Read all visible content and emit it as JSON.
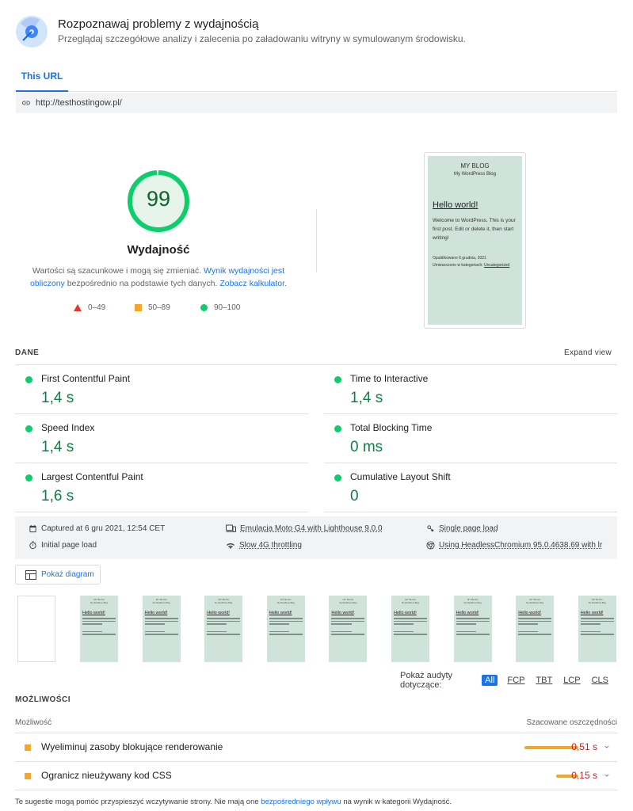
{
  "header": {
    "title": "Rozpoznawaj problemy z wydajnością",
    "subtitle": "Przeglądaj szczegółowe analizy i zalecenia po załadowaniu witryny w symulowanym środowisku."
  },
  "tabs": [
    {
      "label": "This URL",
      "active": true
    }
  ],
  "url": "http://testhostingow.pl/",
  "score": {
    "value": "99",
    "fraction": 0.99,
    "label": "Wydajność",
    "desc_1": "Wartości są szacunkowe i mogą się zmieniać. ",
    "desc_link_1": "Wynik wydajności jest obliczony",
    "desc_2": " bezpośrednio na podstawie tych danych. ",
    "desc_link_2": "Zobacz kalkulator",
    "desc_3": "."
  },
  "legend": {
    "bad": "0–49",
    "average": "50–89",
    "good": "90–100"
  },
  "preview": {
    "blog": "MY BLOG",
    "tagline": "My WordPress Blog",
    "post_title": "Hello world!",
    "body": "Welcome to WordPress. This is your first post. Edit or delete it, then start writing!",
    "published": "Opublikowano 6 grudnia, 2021",
    "category_prefix": "Umieszczono w kategoriach: ",
    "category": "Uncategorized"
  },
  "metrics_section": {
    "title": "DANE",
    "expand": "Expand view",
    "items": [
      {
        "name": "First Contentful Paint",
        "value": "1,4 s"
      },
      {
        "name": "Time to Interactive",
        "value": "1,4 s"
      },
      {
        "name": "Speed Index",
        "value": "1,4 s"
      },
      {
        "name": "Total Blocking Time",
        "value": "0 ms"
      },
      {
        "name": "Largest Contentful Paint",
        "value": "1,6 s"
      },
      {
        "name": "Cumulative Layout Shift",
        "value": "0"
      }
    ]
  },
  "run_info": {
    "captured": "Captured at 6 gru 2021, 12:54 CET",
    "initial_load": "Initial page load",
    "emulation": "Emulacja Moto G4 with Lighthouse 9.0.0",
    "throttling": "Slow 4G throttling",
    "single_load": "Single page load",
    "browser": "Using HeadlessChromium 95.0.4638.69 with lr"
  },
  "diagram_button": "Pokaż diagram",
  "filmstrip": {
    "frame_title": "MY BLOG",
    "frame_sub": "My WordPress Blog",
    "frame_heading": "Hello world!",
    "frames": 9
  },
  "audit_filter": {
    "label": "Pokaż audyty dotyczące:",
    "options": [
      "All",
      "FCP",
      "TBT",
      "LCP",
      "CLS"
    ],
    "active": "All"
  },
  "opportunities": {
    "title": "MOŻLIWOŚCI",
    "col_left": "Możliwość",
    "col_right": "Szacowane oszczędności",
    "items": [
      {
        "title": "Wyeliminuj zasoby blokujące renderowanie",
        "value": "0,51 s",
        "savings_s": 0.51
      },
      {
        "title": "Ogranicz nieużywany kod CSS",
        "value": "0,15 s",
        "savings_s": 0.15
      }
    ]
  },
  "footer": {
    "text_1": "Te sugestie mogą pomóc przyspieszyć wczytywanie strony. Nie mają one ",
    "link": "bezpośredniego wpływu",
    "text_2": " na wynik w kategorii Wydajność."
  },
  "colors": {
    "good": "#0cce6b",
    "average": "#f4a62a",
    "bad": "#e8362d",
    "accent": "#1a73e8"
  }
}
